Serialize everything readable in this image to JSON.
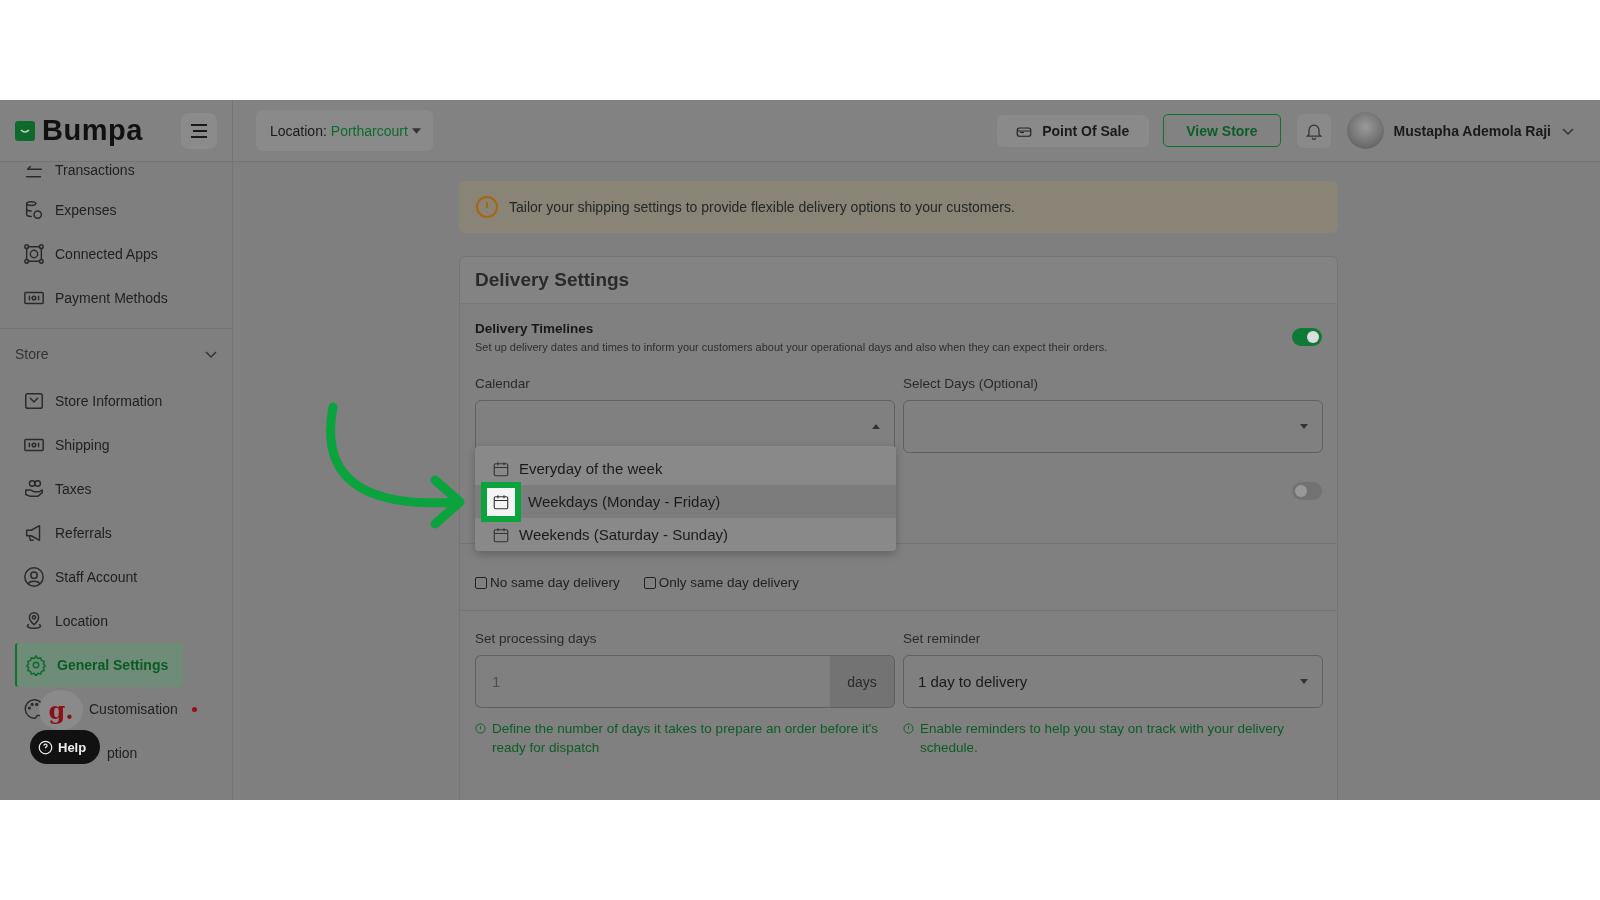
{
  "brand": {
    "name": "Bumpa"
  },
  "header": {
    "location_label": "Location:",
    "location_value": "Portharcourt",
    "pos_button": "Point Of Sale",
    "view_store_button": "View Store",
    "user_name": "Mustapha Ademola Raji"
  },
  "sidebar": {
    "items": [
      {
        "label": "Transactions",
        "selected": false
      },
      {
        "label": "Expenses",
        "selected": false
      },
      {
        "label": "Connected Apps",
        "selected": false
      },
      {
        "label": "Payment Methods",
        "selected": false
      }
    ],
    "section": {
      "title": "Store",
      "expanded": true,
      "items": [
        {
          "label": "Store Information",
          "selected": false,
          "dot": false
        },
        {
          "label": "Shipping",
          "selected": false,
          "dot": false
        },
        {
          "label": "Taxes",
          "selected": false,
          "dot": false
        },
        {
          "label": "Referrals",
          "selected": false,
          "dot": false
        },
        {
          "label": "Staff Account",
          "selected": false,
          "dot": false
        },
        {
          "label": "Location",
          "selected": false,
          "dot": false
        },
        {
          "label": "General Settings",
          "selected": true,
          "dot": false
        },
        {
          "label": "Customisation",
          "selected": false,
          "dot": true
        },
        {
          "label": "ption",
          "selected": false,
          "dot": false
        }
      ]
    }
  },
  "help_widget": {
    "badge": "g.",
    "label": "Help"
  },
  "notice": "Tailor your shipping settings to provide flexible delivery options to your customers.",
  "delivery_settings": {
    "title": "Delivery Settings",
    "timelines": {
      "title": "Delivery Timelines",
      "description": "Set up delivery dates and times to inform your customers about your operational days and also when they can expect their orders.",
      "on": true
    },
    "calendar": {
      "label": "Calendar",
      "expanded": true,
      "options": [
        {
          "label": "Everyday of the week",
          "selected": false
        },
        {
          "label": "Weekdays (Monday - Friday)",
          "selected": true
        },
        {
          "label": "Weekends (Saturday - Sunday)",
          "selected": false
        }
      ]
    },
    "select_days": {
      "label": "Select Days (Optional)"
    },
    "second_toggle": {
      "on": false
    },
    "checkboxes": [
      {
        "label": "No same day delivery",
        "checked": false
      },
      {
        "label": "Only same day delivery",
        "checked": false
      }
    ],
    "processing": {
      "label": "Set processing days",
      "placeholder": "1",
      "unit": "days",
      "hint": "Define the number of days it takes to prepare an order before it's ready for dispatch"
    },
    "reminder": {
      "label": "Set reminder",
      "value": "1 day to delivery",
      "hint": "Enable reminders to help you stay on track with your delivery schedule."
    }
  }
}
